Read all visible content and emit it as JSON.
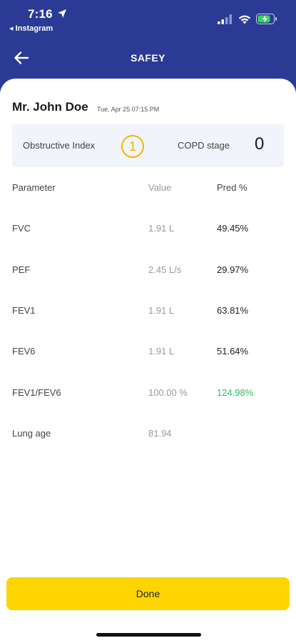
{
  "status_bar": {
    "time": "7:16",
    "back_app": "◂ Instagram"
  },
  "header": {
    "title": "SAFEY"
  },
  "patient": {
    "name": "Mr. John Doe",
    "datetime": "Tue, Apr 25   07:15 PM"
  },
  "summary": {
    "obstructive_index_label": "Obstructive Index",
    "obstructive_index_value": "1",
    "copd_stage_label": "COPD stage",
    "copd_stage_value": "0"
  },
  "table": {
    "headers": [
      "Parameter",
      "Value",
      "Pred %"
    ],
    "rows": [
      {
        "parameter": "FVC",
        "value": "1.91 L",
        "pred": "49.45%"
      },
      {
        "parameter": "PEF",
        "value": "2.45 L/s",
        "pred": "29.97%"
      },
      {
        "parameter": "FEV1",
        "value": "1.91 L",
        "pred": "63.81%"
      },
      {
        "parameter": "FEV6",
        "value": "1.91 L",
        "pred": "51.64%"
      },
      {
        "parameter": "FEV1/FEV6",
        "value": "100.00 %",
        "pred": "124.98%"
      },
      {
        "parameter": "Lung age",
        "value": "81.94",
        "pred": ""
      }
    ]
  },
  "actions": {
    "done_label": "Done"
  },
  "colors": {
    "brand_blue": "#2b3a94",
    "accent_yellow": "#ffd500",
    "index_badge": "#f2b705",
    "pred_high": "#2bc05a"
  }
}
